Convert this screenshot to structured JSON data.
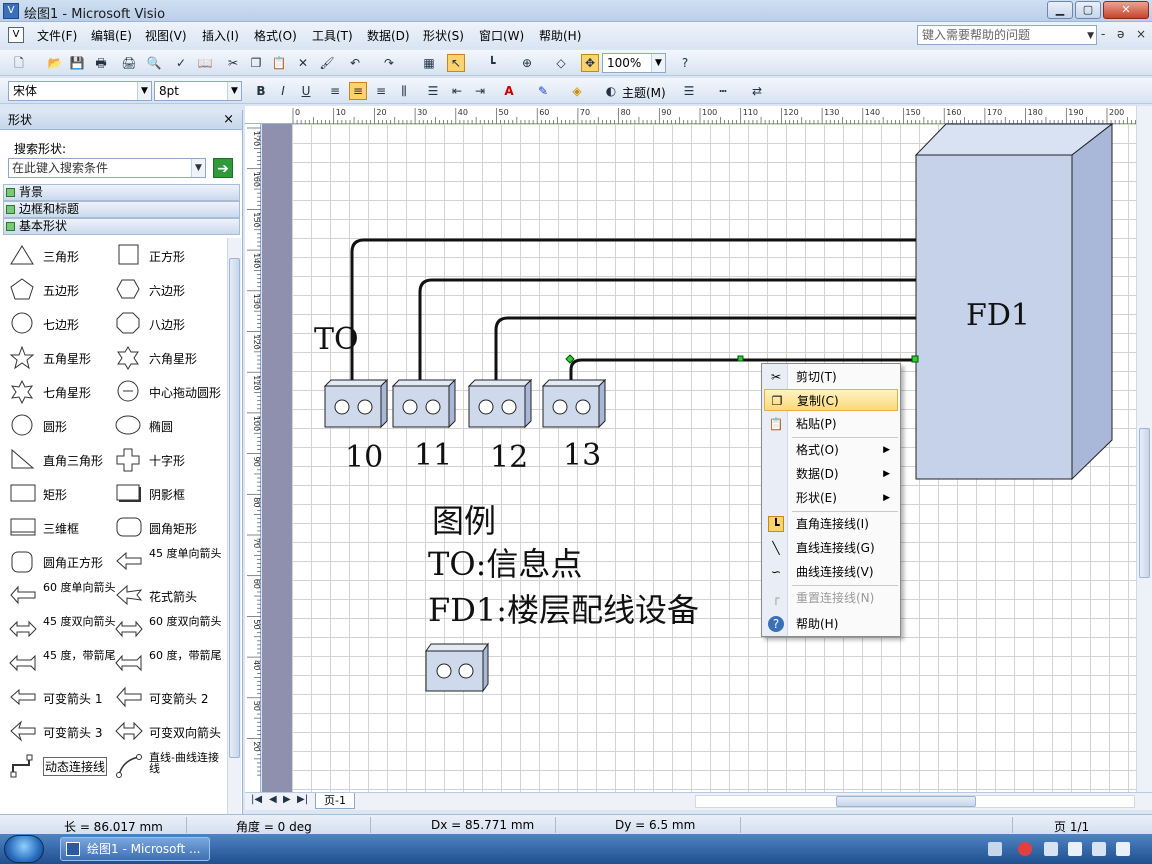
{
  "window": {
    "title": "绘图1 - Microsoft Visio",
    "min": "▁",
    "max": "▢",
    "close": "✕"
  },
  "menubar": {
    "items": [
      "文件(F)",
      "编辑(E)",
      "视图(V)",
      "插入(I)",
      "格式(O)",
      "工具(T)",
      "数据(D)",
      "形状(S)",
      "窗口(W)",
      "帮助(H)"
    ],
    "help_placeholder": "键入需要帮助的问题",
    "mdi_min": "-",
    "mdi_restore": "ǝ",
    "mdi_close": "×"
  },
  "toolbar": {
    "zoom": "100%",
    "font": "宋体",
    "size": "8pt",
    "theme_label": "主题(M)"
  },
  "shapes_panel": {
    "title": "形状",
    "close": "×",
    "search_label": "搜索形状:",
    "search_placeholder": "在此键入搜索条件",
    "stencils": [
      "背景",
      "边框和标题",
      "基本形状"
    ],
    "shapes": [
      "三角形",
      "正方形",
      "五边形",
      "六边形",
      "七边形",
      "八边形",
      "五角星形",
      "六角星形",
      "七角星形",
      "中心拖动圆形",
      "圆形",
      "椭圆",
      "直角三角形",
      "十字形",
      "矩形",
      "阴影框",
      "三维框",
      "圆角矩形",
      "圆角正方形",
      "45 度单向箭头",
      "60 度单向箭头",
      "花式箭头",
      "45 度双向箭头",
      "60 度双向箭头",
      "45 度，带箭尾",
      "60 度，带箭尾",
      "可变箭头 1",
      "可变箭头 2",
      "可变箭头 3",
      "可变双向箭头",
      "动态连接线",
      "直线-曲线连接线"
    ]
  },
  "ruler": {
    "h": [
      "0",
      "10",
      "20",
      "30",
      "40",
      "50",
      "60",
      "70",
      "80",
      "90",
      "100",
      "110",
      "120",
      "130",
      "140",
      "150",
      "160",
      "170",
      "180",
      "190",
      "200"
    ],
    "v": [
      "170",
      "160",
      "150",
      "140",
      "130",
      "120",
      "110",
      "100",
      "90",
      "80",
      "70",
      "60",
      "50",
      "40",
      "30",
      "20"
    ]
  },
  "diagram": {
    "to_label": "TO",
    "outlets": [
      "10",
      "11",
      "12",
      "13"
    ],
    "fd_label": "FD1",
    "legend_title": "图例",
    "legend_to": "TO:信息点",
    "legend_fd": "FD1:楼层配线设备"
  },
  "context_menu": [
    {
      "label": "剪切(T)",
      "icon": "scissors-icon",
      "glyph": "✂"
    },
    {
      "label": "复制(C)",
      "icon": "copy-icon",
      "glyph": "❐"
    },
    {
      "label": "粘贴(P)",
      "icon": "paste-icon",
      "glyph": "📋"
    },
    {
      "label": "格式(O)",
      "submenu": true
    },
    {
      "label": "数据(D)",
      "submenu": true
    },
    {
      "label": "形状(E)",
      "submenu": true
    },
    {
      "label": "直角连接线(I)",
      "icon": "right-angle-connector-icon",
      "glyph": "┗"
    },
    {
      "label": "直线连接线(G)",
      "icon": "straight-connector-icon",
      "glyph": "╲"
    },
    {
      "label": "曲线连接线(V)",
      "icon": "curved-connector-icon",
      "glyph": "∽"
    },
    {
      "label": "重置连接线(N)",
      "icon": "reset-connector-icon",
      "glyph": "┌",
      "disabled": true
    },
    {
      "label": "帮助(H)",
      "icon": "help-icon",
      "glyph": "?"
    }
  ],
  "page_tab": "页-1",
  "statusbar": {
    "length": "长 = 86.017 mm",
    "angle": "角度 = 0 deg",
    "dx": "Dx = 85.771 mm",
    "dy": "Dy = 6.5 mm",
    "page": "页 1/1"
  },
  "taskbar": {
    "item": "绘图1 - Microsoft ..."
  },
  "colors": {
    "accent": "#fad97a",
    "canvas_bg": "#8f8fae",
    "fd_fill": "#c5d2ea",
    "outlet_fill": "#cfd9ec"
  }
}
